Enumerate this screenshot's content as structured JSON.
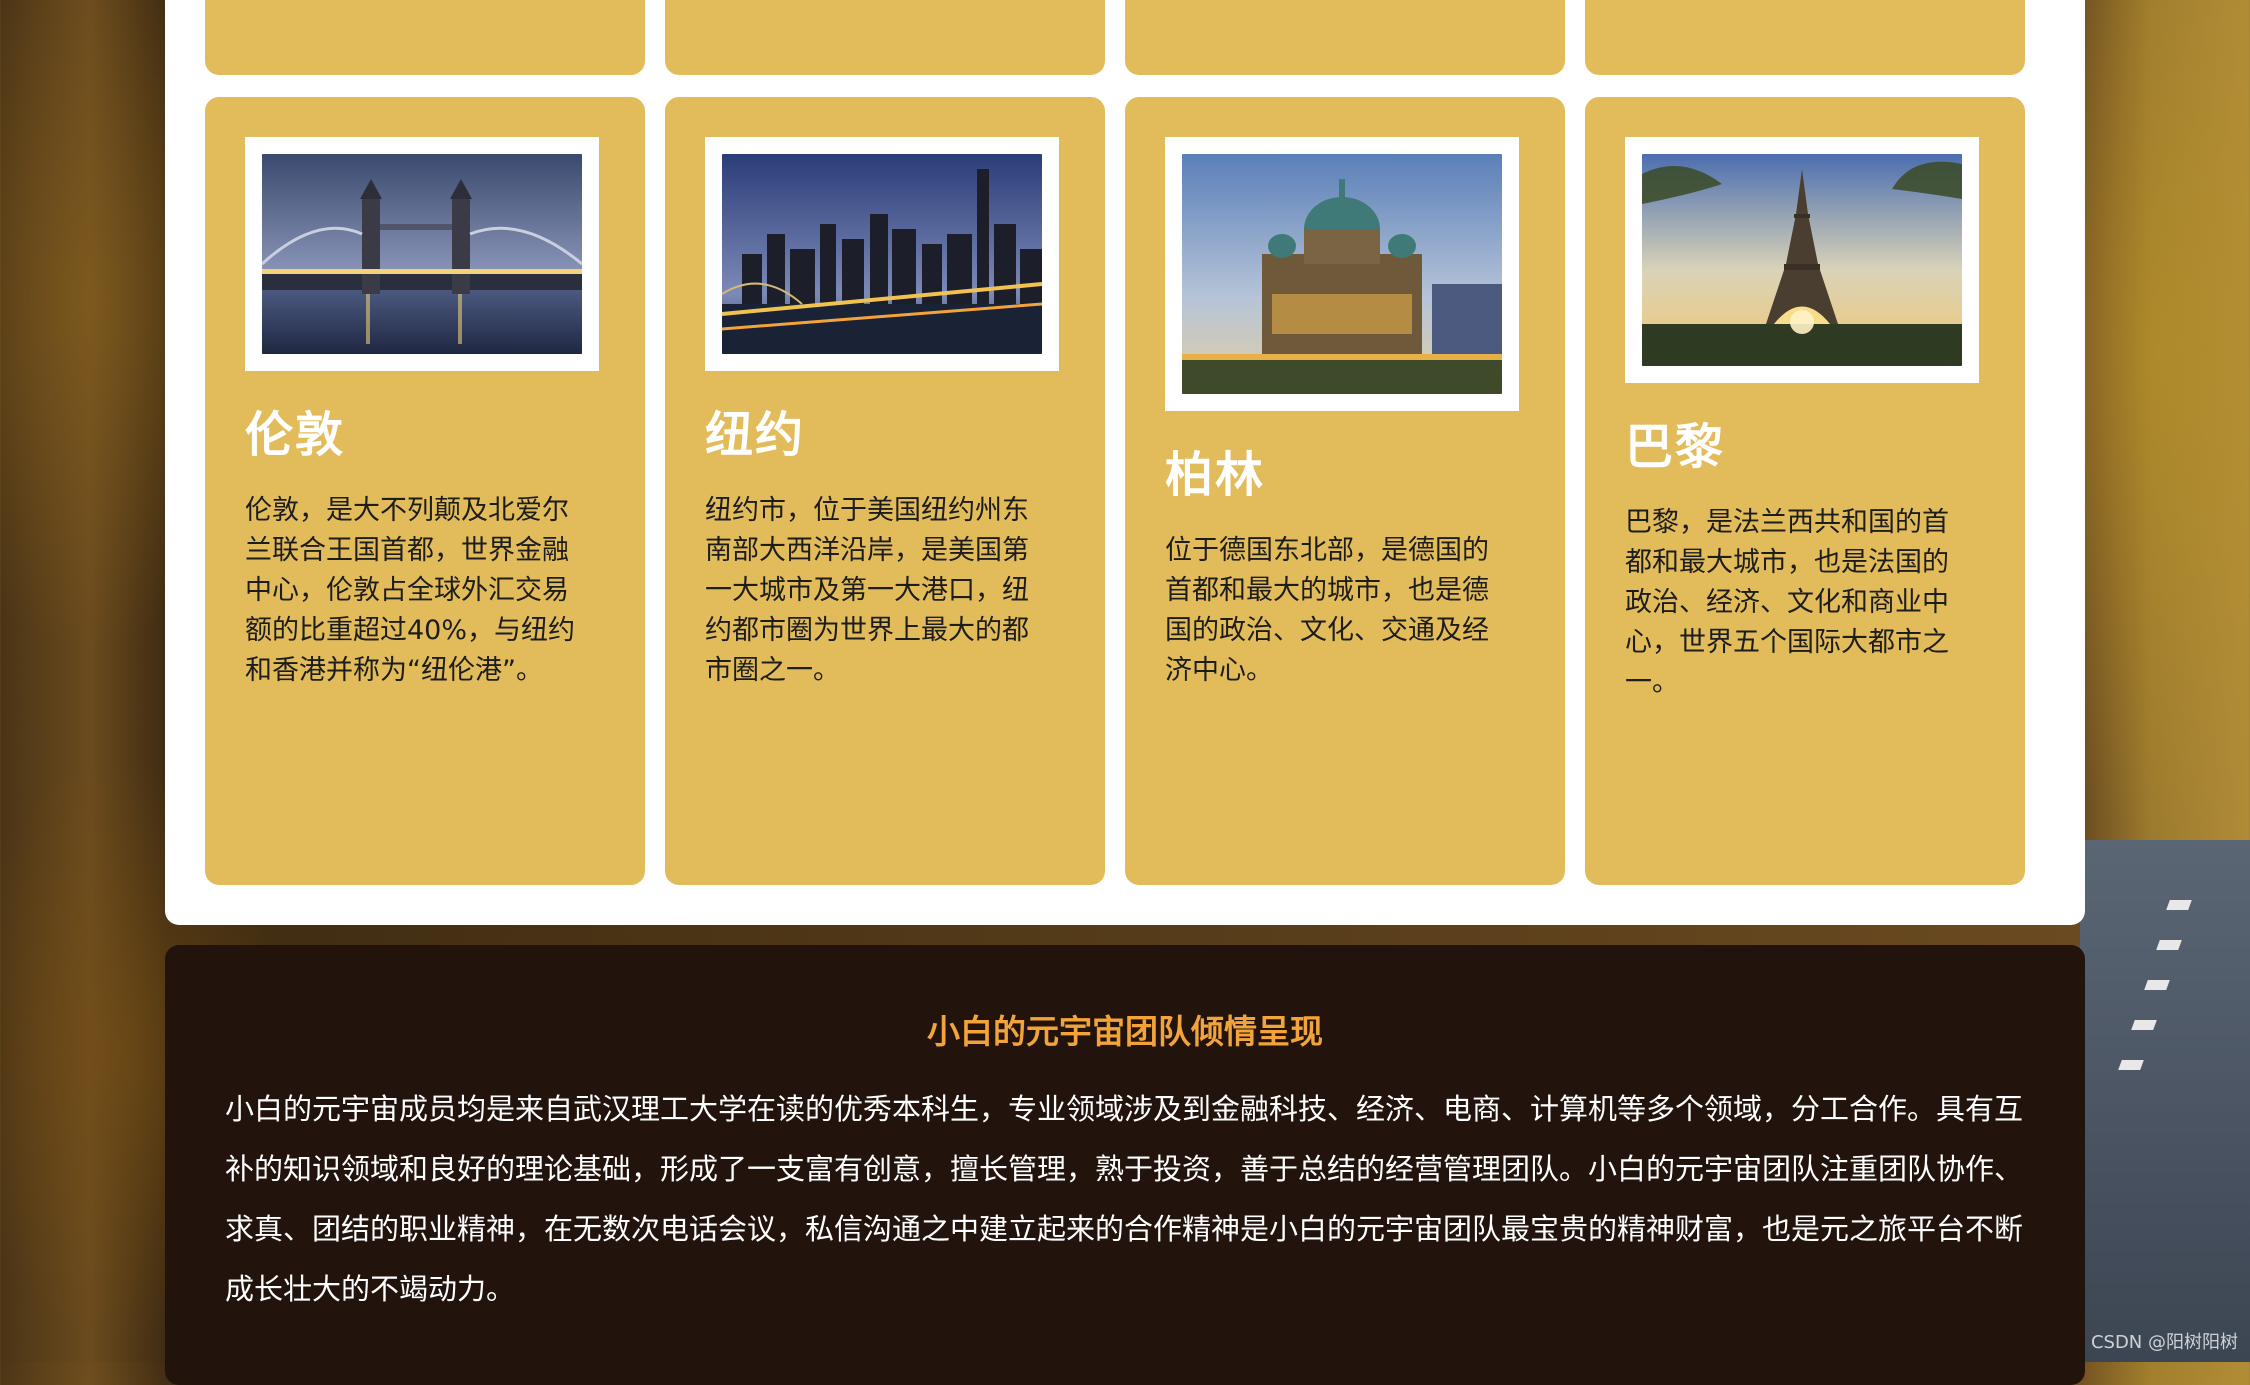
{
  "cities": [
    {
      "name": "伦敦",
      "desc": "伦敦，是大不列颠及北爱尔兰联合王国首都，世界金融中心，伦敦占全球外汇交易额的比重超过40%，与纽约和香港并称为“纽伦港”。",
      "image": "tower-bridge-night"
    },
    {
      "name": "纽约",
      "desc": "纽约市，位于美国纽约州东南部大西洋沿岸，是美国第一大城市及第一大港口，纽约都市圈为世界上最大的都市圈之一。",
      "image": "new-york-skyline-night"
    },
    {
      "name": "柏林",
      "desc": "位于德国东北部，是德国的首都和最大的城市，也是德国的政治、文化、交通及经济中心。",
      "image": "berlin-cathedral"
    },
    {
      "name": "巴黎",
      "desc": "巴黎，是法兰西共和国的首都和最大城市，也是法国的政治、经济、文化和商业中心，世界五个国际大都市之一。",
      "image": "eiffel-tower"
    }
  ],
  "footer": {
    "title": "小白的元宇宙团队倾情呈现",
    "text": "小白的元宇宙成员均是来自武汉理工大学在读的优秀本科生，专业领域涉及到金融科技、经济、电商、计算机等多个领域，分工合作。具有互补的知识领域和良好的理论基础，形成了一支富有创意，擅长管理，熟于投资，善于总结的经营管理团队。小白的元宇宙团队注重团队协作、求真、团结的职业精神，在无数次电话会议，私信沟通之中建立起来的合作精神是小白的元宇宙团队最宝贵的精神财富，也是元之旅平台不断成长壮大的不竭动力。"
  },
  "watermark": "CSDN @阳树阳树",
  "colors": {
    "card": "#e2bc5b",
    "footer_bg": "#22140c",
    "footer_title": "#f2a43a"
  }
}
